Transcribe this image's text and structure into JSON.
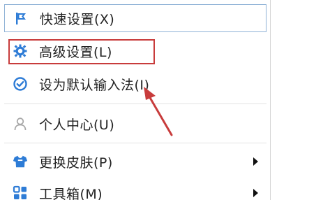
{
  "menu": {
    "items": [
      {
        "label": "快速设置(X)",
        "icon": "flag-icon"
      },
      {
        "label": "高级设置(L)",
        "icon": "gear-icon"
      },
      {
        "label": "设为默认输入法(I)",
        "icon": "check-circle-icon"
      },
      {
        "label": "个人中心(U)",
        "icon": "user-icon"
      },
      {
        "label": "更换皮肤(P)",
        "icon": "shirt-icon",
        "submenu": true
      },
      {
        "label": "工具箱(M)",
        "icon": "grid-icon",
        "submenu": true
      }
    ]
  },
  "colors": {
    "icon_blue": "#2e7cd6",
    "icon_gray": "#a8a8a8",
    "annotation_red": "#c83c3c",
    "hover_border": "#8fb2d6"
  }
}
